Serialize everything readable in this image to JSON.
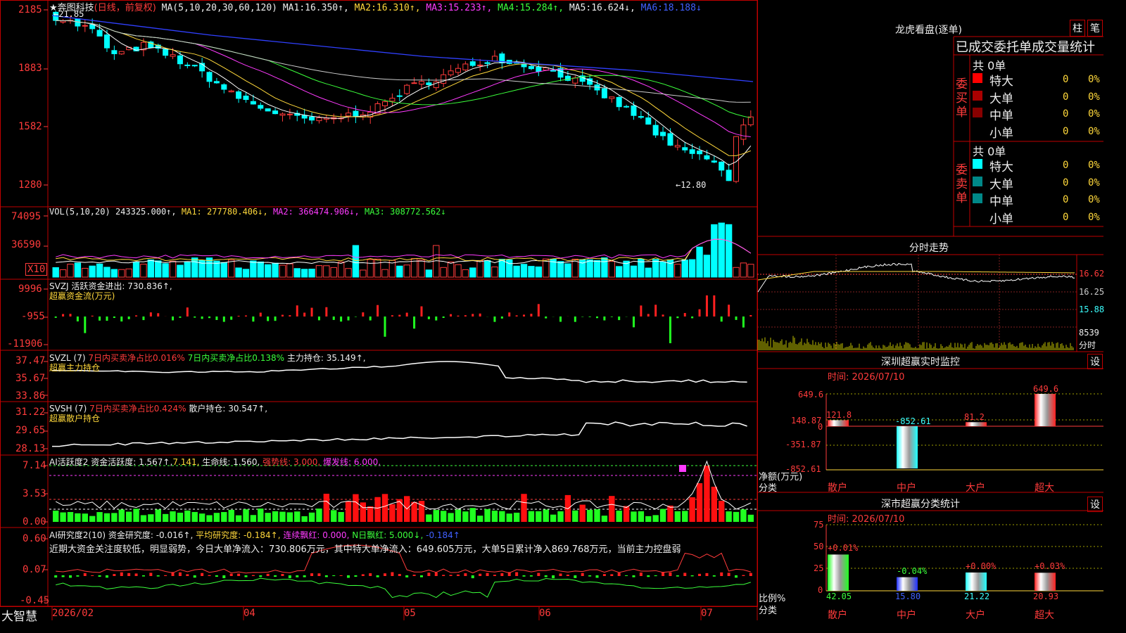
{
  "header": {
    "stock": "★奔图科技",
    "mode": "(日线，前复权)",
    "ma_label": "MA(5,10,20,30,60,120)",
    "ma": [
      {
        "label": "MA1:",
        "val": "16.350↑,"
      },
      {
        "label": "MA2:",
        "val": "16.310↑,"
      },
      {
        "label": "MA3:",
        "val": "15.233↑,"
      },
      {
        "label": "MA4:",
        "val": "15.284↑,"
      },
      {
        "label": "MA5:",
        "val": "16.624↓,"
      },
      {
        "label": "MA6:",
        "val": "18.188↓"
      }
    ]
  },
  "price_axis": [
    "2185",
    "1883",
    "1582",
    "1280"
  ],
  "hi_label": "←21.85",
  "lo_label": "←12.80",
  "vol": {
    "label": "VOL(5,10,20)",
    "v": "243325.000↑,",
    "ma1": "MA1: 277780.406↓,",
    "ma2": "MA2: 366474.906↓,",
    "ma3": "MA3: 308772.562↓",
    "axis": [
      "74095",
      "36590"
    ],
    "x10": "X10"
  },
  "svzj": {
    "label": "SVZJ  活跃资金进出: 730.836↑,",
    "sub": "超赢资金流(万元)",
    "axis": [
      "9996",
      "-955",
      "-11906"
    ]
  },
  "svzl": {
    "label": "SVZL (7)",
    "a": "7日内买卖净占比0.016%",
    "b": "7日内买卖净占比0.138%",
    "c": "主力持仓: 35.149↑,",
    "sub": "超赢主力持仓",
    "axis": [
      "37.47",
      "35.67",
      "33.86"
    ]
  },
  "svsh": {
    "label": "SVSH (7)",
    "a": "7日内买卖净占比0.424%",
    "c": "散户持仓: 30.547↑,",
    "sub": "超赢散户持仓",
    "axis": [
      "31.22",
      "29.65",
      "28.13"
    ]
  },
  "ai1": {
    "label": "AI活跃度2",
    "a": "资金活跃度: 1.567↑,",
    "b": "7.141,",
    "c": "生命线: 1.560,",
    "d": "强势线: 3.000,",
    "e": "爆发线: 6.000,",
    "axis": [
      "7.14",
      "3.53",
      "0.00"
    ]
  },
  "ai2": {
    "label": "AI研究度2(10)",
    "a": "资金研究度: -0.016↑,",
    "b": "平均研究度: -0.184↑,",
    "c": "连续飘红: 0.000,",
    "d": "N日飘红: 5.000↓,",
    "e": "-0.184↑",
    "text": "近期大资金关注度较低，明显弱势，今日大单净流入：730.806万元，其中特大单净流入：649.605万元，大单5日累计净入869.768万元，当前主力控盘弱",
    "axis": [
      "0.60",
      "0.07",
      "-0.45"
    ]
  },
  "bottom": {
    "logo": "大智慧",
    "dates": [
      "2026/02",
      "04",
      "05",
      "06",
      "07"
    ]
  },
  "right": {
    "lhb_title": "龙虎看盘(逐单)",
    "btn1": "柱",
    "btn2": "笔",
    "stat_title": "已成交委托单成交量统计",
    "buy": {
      "side": "委买单",
      "total": "共 0单",
      "rows": [
        {
          "name": "特大",
          "n": "0",
          "p": "0%"
        },
        {
          "name": "大单",
          "n": "0",
          "p": "0%"
        },
        {
          "name": "中单",
          "n": "0",
          "p": "0%"
        },
        {
          "name": "小单",
          "n": "0",
          "p": "0%"
        }
      ]
    },
    "sell": {
      "side": "委卖单",
      "total": "共 0单",
      "rows": [
        {
          "name": "特大",
          "n": "0",
          "p": "0%"
        },
        {
          "name": "大单",
          "n": "0",
          "p": "0%"
        },
        {
          "name": "中单",
          "n": "0",
          "p": "0%"
        },
        {
          "name": "小单",
          "n": "0",
          "p": "0%"
        }
      ]
    },
    "fs": {
      "title": "分时走势",
      "axis": [
        "16.62",
        "16.25",
        "15.88"
      ],
      "vol": "8539",
      "unit": "分时"
    },
    "mon": {
      "title": "深圳超赢实时监控",
      "btn": "设",
      "time": "时间: 2026/07/10",
      "axis": [
        "649.6",
        "148.87",
        "0",
        "-351.87",
        "-852.61"
      ],
      "ylabel": "净额(万元)",
      "xlabel": "分类",
      "cats": [
        "散户",
        "中户",
        "大户",
        "超大"
      ],
      "vals": [
        "121.8",
        "-852.61",
        "81.2",
        "649.6"
      ]
    },
    "cls": {
      "title": "深市超赢分类统计",
      "btn": "设",
      "time": "时间: 2026/07/10",
      "axis": [
        "75",
        "50",
        "25",
        "0"
      ],
      "ylabel": "比例%",
      "xlabel": "分类",
      "cats": [
        "散户",
        "中户",
        "大户",
        "超大"
      ],
      "pct": [
        "+0.01%",
        "-0.04%",
        "+0.00%",
        "+0.03%"
      ],
      "vals": [
        "42.05",
        "15.80",
        "21.22",
        "20.93"
      ]
    }
  },
  "chart_data": {
    "type": "candlestick",
    "x_ticks": [
      "2026/02",
      "04",
      "05",
      "06",
      "07"
    ],
    "ylim": [
      12.8,
      21.85
    ],
    "y_ticks": [
      21.85,
      18.83,
      15.82,
      12.8
    ],
    "high": 21.85,
    "low": 12.8,
    "mon_values": [
      121.8,
      -852.61,
      81.2,
      649.6
    ],
    "cls_values": [
      42.05,
      15.8,
      21.22,
      20.93
    ]
  },
  "colors": {
    "up": "#ff3b3b",
    "down": "#00ffff",
    "frame": "#c00000"
  }
}
